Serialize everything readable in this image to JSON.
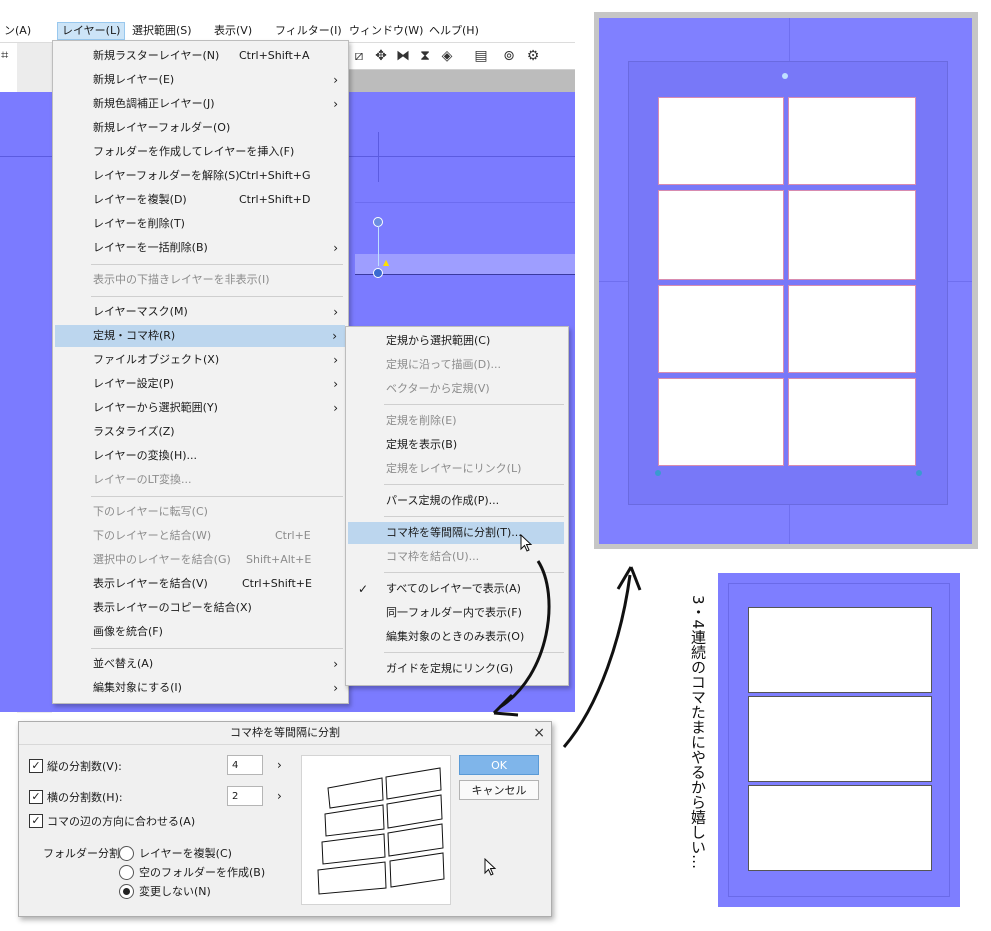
{
  "menubar": {
    "items": [
      {
        "label": "ン(A)"
      },
      {
        "label": "レイヤー(L)"
      },
      {
        "label": "選択範囲(S)"
      },
      {
        "label": "表示(V)"
      },
      {
        "label": "フィルター(I)"
      },
      {
        "label": "ウィンドウ(W)"
      },
      {
        "label": "ヘルプ(H)"
      }
    ]
  },
  "layer_menu": {
    "items": [
      {
        "label": "新規ラスターレイヤー(N)",
        "shortcut": "Ctrl+Shift+A"
      },
      {
        "label": "新規レイヤー(E)",
        "arrow": "›"
      },
      {
        "label": "新規色調補正レイヤー(J)",
        "arrow": "›"
      },
      {
        "label": "新規レイヤーフォルダー(O)"
      },
      {
        "label": "フォルダーを作成してレイヤーを挿入(F)"
      },
      {
        "label": "レイヤーフォルダーを解除(S)",
        "shortcut": "Ctrl+Shift+G"
      },
      {
        "label": "レイヤーを複製(D)",
        "shortcut": "Ctrl+Shift+D"
      },
      {
        "label": "レイヤーを削除(T)"
      },
      {
        "label": "レイヤーを一括削除(B)",
        "arrow": "›"
      },
      {
        "label": "表示中の下描きレイヤーを非表示(I)"
      },
      {
        "label": "レイヤーマスク(M)",
        "arrow": "›"
      },
      {
        "label": "定規・コマ枠(R)",
        "arrow": "›"
      },
      {
        "label": "ファイルオブジェクト(X)",
        "arrow": "›"
      },
      {
        "label": "レイヤー設定(P)",
        "arrow": "›"
      },
      {
        "label": "レイヤーから選択範囲(Y)",
        "arrow": "›"
      },
      {
        "label": "ラスタライズ(Z)"
      },
      {
        "label": "レイヤーの変換(H)..."
      },
      {
        "label": "レイヤーのLT変換..."
      },
      {
        "label": "下のレイヤーに転写(C)"
      },
      {
        "label": "下のレイヤーと結合(W)",
        "shortcut": "Ctrl+E"
      },
      {
        "label": "選択中のレイヤーを結合(G)",
        "shortcut": "Shift+Alt+E"
      },
      {
        "label": "表示レイヤーを結合(V)",
        "shortcut": "Ctrl+Shift+E"
      },
      {
        "label": "表示レイヤーのコピーを結合(X)"
      },
      {
        "label": "画像を統合(F)"
      },
      {
        "label": "並べ替え(A)",
        "arrow": "›"
      },
      {
        "label": "編集対象にする(I)",
        "arrow": "›"
      }
    ]
  },
  "ruler_submenu": {
    "items": [
      {
        "label": "定規から選択範囲(C)"
      },
      {
        "label": "定規に沿って描画(D)..."
      },
      {
        "label": "ベクターから定規(V)"
      },
      {
        "label": "定規を削除(E)"
      },
      {
        "label": "定規を表示(B)"
      },
      {
        "label": "定規をレイヤーにリンク(L)"
      },
      {
        "label": "パース定規の作成(P)..."
      },
      {
        "label": "コマ枠を等間隔に分割(T)..."
      },
      {
        "label": "コマ枠を結合(U)..."
      },
      {
        "label": "すべてのレイヤーで表示(A)",
        "check": "✓"
      },
      {
        "label": "同一フォルダー内で表示(F)"
      },
      {
        "label": "編集対象のときのみ表示(O)"
      },
      {
        "label": "ガイドを定規にリンク(G)"
      }
    ]
  },
  "dialog": {
    "title": "コマ枠を等間隔に分割",
    "close": "×",
    "vertical_label": "縦の分割数(V):",
    "vertical_value": "4",
    "horizontal_label": "横の分割数(H):",
    "horizontal_value": "2",
    "align_label": "コマの辺の方向に合わせる(A)",
    "check": "✓",
    "spin": "›",
    "folder_label": "フォルダー分割:",
    "radio_duplicate": "レイヤーを複製(C)",
    "radio_empty_folder": "空のフォルダーを作成(B)",
    "radio_no_change": "変更しない(N)",
    "ok": "OK",
    "cancel": "キャンセル"
  },
  "annotation": {
    "text": "3・4連続のコマたまにやるから嬉しい…"
  },
  "colors": {
    "canvas_blue": "#7b7bff",
    "menu_highlight": "#bcd6ee",
    "ok_button": "#7fb5ea",
    "panel_border": "#d88cb0"
  }
}
